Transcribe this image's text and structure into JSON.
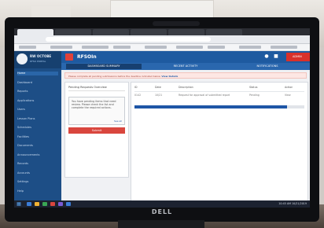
{
  "app": {
    "title": "RFSOIn",
    "org_name": "RW OCTOBE",
    "org_sub": "RFSO PORTAL"
  },
  "browser": {
    "tab_count": 6,
    "bookmark_count": 9
  },
  "sidebar": {
    "items": [
      {
        "label": "Home",
        "active": true
      },
      {
        "label": "Dashboard",
        "active": false
      },
      {
        "label": "Reports",
        "active": false
      },
      {
        "label": "Applications",
        "active": false
      },
      {
        "label": "Users",
        "active": false
      },
      {
        "label": "Lesson Plans",
        "active": false
      },
      {
        "label": "Schedules",
        "active": false
      },
      {
        "label": "Facilities",
        "active": false
      },
      {
        "label": "Documents",
        "active": false
      },
      {
        "label": "Announcements",
        "active": false
      },
      {
        "label": "Records",
        "active": false
      },
      {
        "label": "Accounts",
        "active": false
      },
      {
        "label": "Settings",
        "active": false
      },
      {
        "label": "Help",
        "active": false
      }
    ]
  },
  "topbar": {
    "user_label": "ADMIN"
  },
  "subnav": {
    "tabs": [
      {
        "label": "DASHBOARD SUMMARY",
        "active": true
      },
      {
        "label": "RECENT ACTIVITY",
        "active": false
      },
      {
        "label": "NOTIFICATIONS",
        "active": false
      }
    ]
  },
  "notice": {
    "text": "Please complete all pending submissions before the deadline indicated below.",
    "link": "View Details"
  },
  "left_panel": {
    "title": "Pending Requests Overview",
    "alert_text": "You have pending items that need review. Please check the list and complete the required actions.",
    "alert_link": "See all",
    "button_label": "Submit"
  },
  "table": {
    "headers": [
      "ID",
      "Date",
      "Description",
      "Status",
      "Action"
    ],
    "row": [
      "0142",
      "10/21",
      "Request for approval of submitted report",
      "Pending",
      "View"
    ],
    "progress": 0.9
  },
  "taskbar": {
    "tray_text": "10:45 AM  10/21/2019"
  },
  "monitor": {
    "brand": "DELL"
  }
}
